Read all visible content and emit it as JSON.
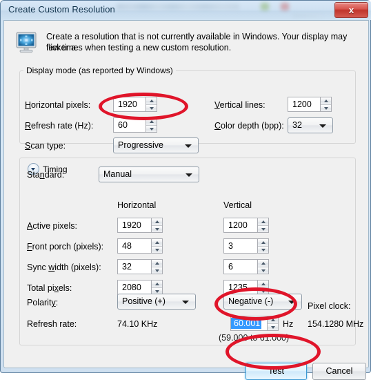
{
  "window": {
    "title": "Create Custom Resolution",
    "close_label": "x"
  },
  "header": {
    "icon": "monitor-icon",
    "description_line1": "Create a resolution that is not currently available in Windows. Your display may flicker a",
    "description_line2": "few times when testing a new custom resolution."
  },
  "display_mode": {
    "legend": "Display mode (as reported by Windows)",
    "horizontal_pixels_label": "Horizontal pixels:",
    "horizontal_pixels_value": "1920",
    "refresh_rate_label": "Refresh rate (Hz):",
    "refresh_rate_value": "60",
    "scan_type_label": "Scan type:",
    "scan_type_value": "Progressive",
    "vertical_lines_label": "Vertical lines:",
    "vertical_lines_value": "1200",
    "color_depth_label": "Color depth (bpp):",
    "color_depth_value": "32"
  },
  "timing": {
    "legend": "Timing",
    "standard_label": "Standard:",
    "standard_value": "Manual",
    "col_horizontal": "Horizontal",
    "col_vertical": "Vertical",
    "rows": [
      {
        "label": "Active pixels:",
        "h": "1920",
        "v": "1200"
      },
      {
        "label": "Front porch (pixels):",
        "h": "48",
        "v": "3"
      },
      {
        "label": "Sync width (pixels):",
        "h": "32",
        "v": "6"
      },
      {
        "label": "Total pixels:",
        "h": "2080",
        "v": "1235"
      }
    ],
    "polarity_label": "Polarity:",
    "polarity_h_value": "Positive (+)",
    "polarity_v_value": "Negative (-)",
    "refresh_rate_label": "Refresh rate:",
    "refresh_rate_h_value": "74.10 KHz",
    "refresh_rate_v_value": "60.001",
    "refresh_rate_unit": "Hz",
    "refresh_rate_range": "(59.000 to 61.000)",
    "pixel_clock_label": "Pixel clock:",
    "pixel_clock_value": "154.1280 MHz"
  },
  "buttons": {
    "test": "Test",
    "cancel": "Cancel"
  },
  "annotations": {
    "ellipse_color": "#e0152a",
    "count": 3
  }
}
